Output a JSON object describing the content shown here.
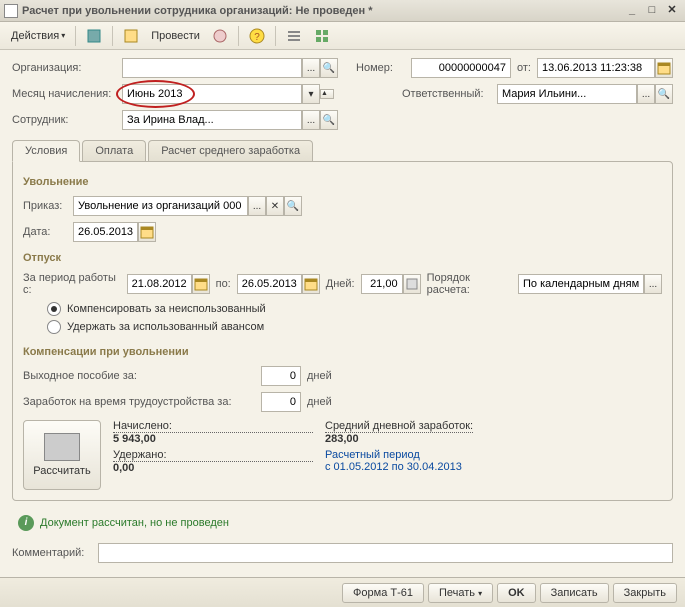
{
  "window": {
    "title": "Расчет при увольнении сотрудника организаций: Не проведен *"
  },
  "toolbar": {
    "actions": "Действия",
    "provesti": "Провести"
  },
  "header": {
    "org_label": "Организация:",
    "org_value": "",
    "month_label": "Месяц начисления:",
    "month_value": "Июнь 2013",
    "emp_label": "Сотрудник:",
    "emp_value": "За Ирина Влад...",
    "number_label": "Номер:",
    "number_value": "00000000047",
    "from_label": "от:",
    "from_value": "13.06.2013 11:23:38",
    "resp_label": "Ответственный:",
    "resp_value": "Мария Ильини..."
  },
  "tabs": {
    "t1": "Условия",
    "t2": "Оплата",
    "t3": "Расчет среднего заработка"
  },
  "dismissal": {
    "title": "Увольнение",
    "order_label": "Приказ:",
    "order_value": "Увольнение из организаций 000",
    "date_label": "Дата:",
    "date_value": "26.05.2013"
  },
  "vacation": {
    "title": "Отпуск",
    "period_label": "За период работы с:",
    "period_from": "21.08.2012",
    "period_to_label": "по:",
    "period_to": "26.05.2013",
    "days_label": "Дней:",
    "days_value": "21,00",
    "calc_order_label": "Порядок расчета:",
    "calc_order_value": "По календарным дням",
    "radio1": "Компенсировать за неиспользованный",
    "radio2": "Удержать за использованный авансом"
  },
  "comp": {
    "title": "Компенсации при увольнении",
    "sev_label": "Выходное пособие за:",
    "sev_value": "0",
    "sev_unit": "дней",
    "earn_label": "Заработок на время трудоустройства за:",
    "earn_value": "0",
    "earn_unit": "дней"
  },
  "calc": {
    "button": "Рассчитать",
    "accrued_label": "Начислено:",
    "accrued_value": "5 943,00",
    "withheld_label": "Удержано:",
    "withheld_value": "0,00",
    "avg_label": "Средний дневной заработок:",
    "avg_value": "283,00",
    "period_label": "Расчетный период",
    "period_value": "с 01.05.2012 по 30.04.2013"
  },
  "status": "Документ рассчитан, но не проведен",
  "comment_label": "Комментарий:",
  "footer": {
    "form": "Форма Т-61",
    "print": "Печать",
    "ok": "OK",
    "save": "Записать",
    "close": "Закрыть"
  }
}
